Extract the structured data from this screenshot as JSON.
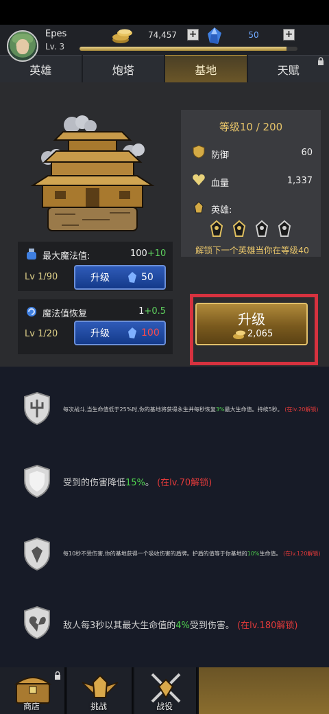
{
  "player": {
    "name": "Epes",
    "level": "Lv. 3",
    "xp_fraction": 0.95
  },
  "currency": {
    "coins": "74,457",
    "gems": "50",
    "add_symbol": "+"
  },
  "tabs": [
    {
      "label": "英雄",
      "active": false
    },
    {
      "label": "炮塔",
      "active": false
    },
    {
      "label": "基地",
      "active": true
    },
    {
      "label": "天赋",
      "active": false,
      "locked": true
    }
  ],
  "stats": [
    {
      "title": "最大魔法值:",
      "value": "100",
      "bonus": "+10",
      "level": "Lv 1/90",
      "button": "升级",
      "cost": "50",
      "cost_affordable": true
    },
    {
      "title": "魔法值恢复",
      "value": "1",
      "bonus": "+0.5",
      "level": "Lv 1/20",
      "button": "升级",
      "cost": "100",
      "cost_affordable": false
    }
  ],
  "base_info": {
    "title": "等级10 / 200",
    "defense_label": "防御",
    "defense_value": "60",
    "hp_label": "血量",
    "hp_value": "1,337",
    "heroes_label": "英雄:",
    "unlock_text": "解锁下一个英雄当你在等级40"
  },
  "main_upgrade": {
    "label": "升级",
    "cost": "2,065"
  },
  "skills": [
    {
      "text_pre": "每次战斗,当生命值低于25%时,你的基地将获得永生并每秒恢复",
      "highlight": "3%",
      "text_post": "最大生命值。持续5秒。",
      "lock": "(在lv.20解锁)"
    },
    {
      "text_pre": "受到的伤害降低",
      "highlight": "15%",
      "text_post": "。",
      "lock": "(在lv.70解锁)"
    },
    {
      "text_pre": "每10秒不受伤害,你的基地获得一个吸收伤害的盾牌。护盾的值等于你基地的",
      "highlight": "10%",
      "text_post": "生命值。",
      "lock": "(在lv.120解锁)"
    },
    {
      "text_pre": "敌人每3秒以其最大生命值的",
      "highlight": "4%",
      "text_post": "受到伤害。",
      "lock": "(在lv.180解锁)"
    }
  ],
  "nav": [
    {
      "label": "商店",
      "locked": true
    },
    {
      "label": "挑战"
    },
    {
      "label": "战役"
    },
    {
      "label": ""
    }
  ],
  "colors": {
    "accent_gold": "#e8c56a",
    "highlight_red": "#d6323f",
    "green": "#4fd24f",
    "blue_button": "#2f5bb8"
  }
}
